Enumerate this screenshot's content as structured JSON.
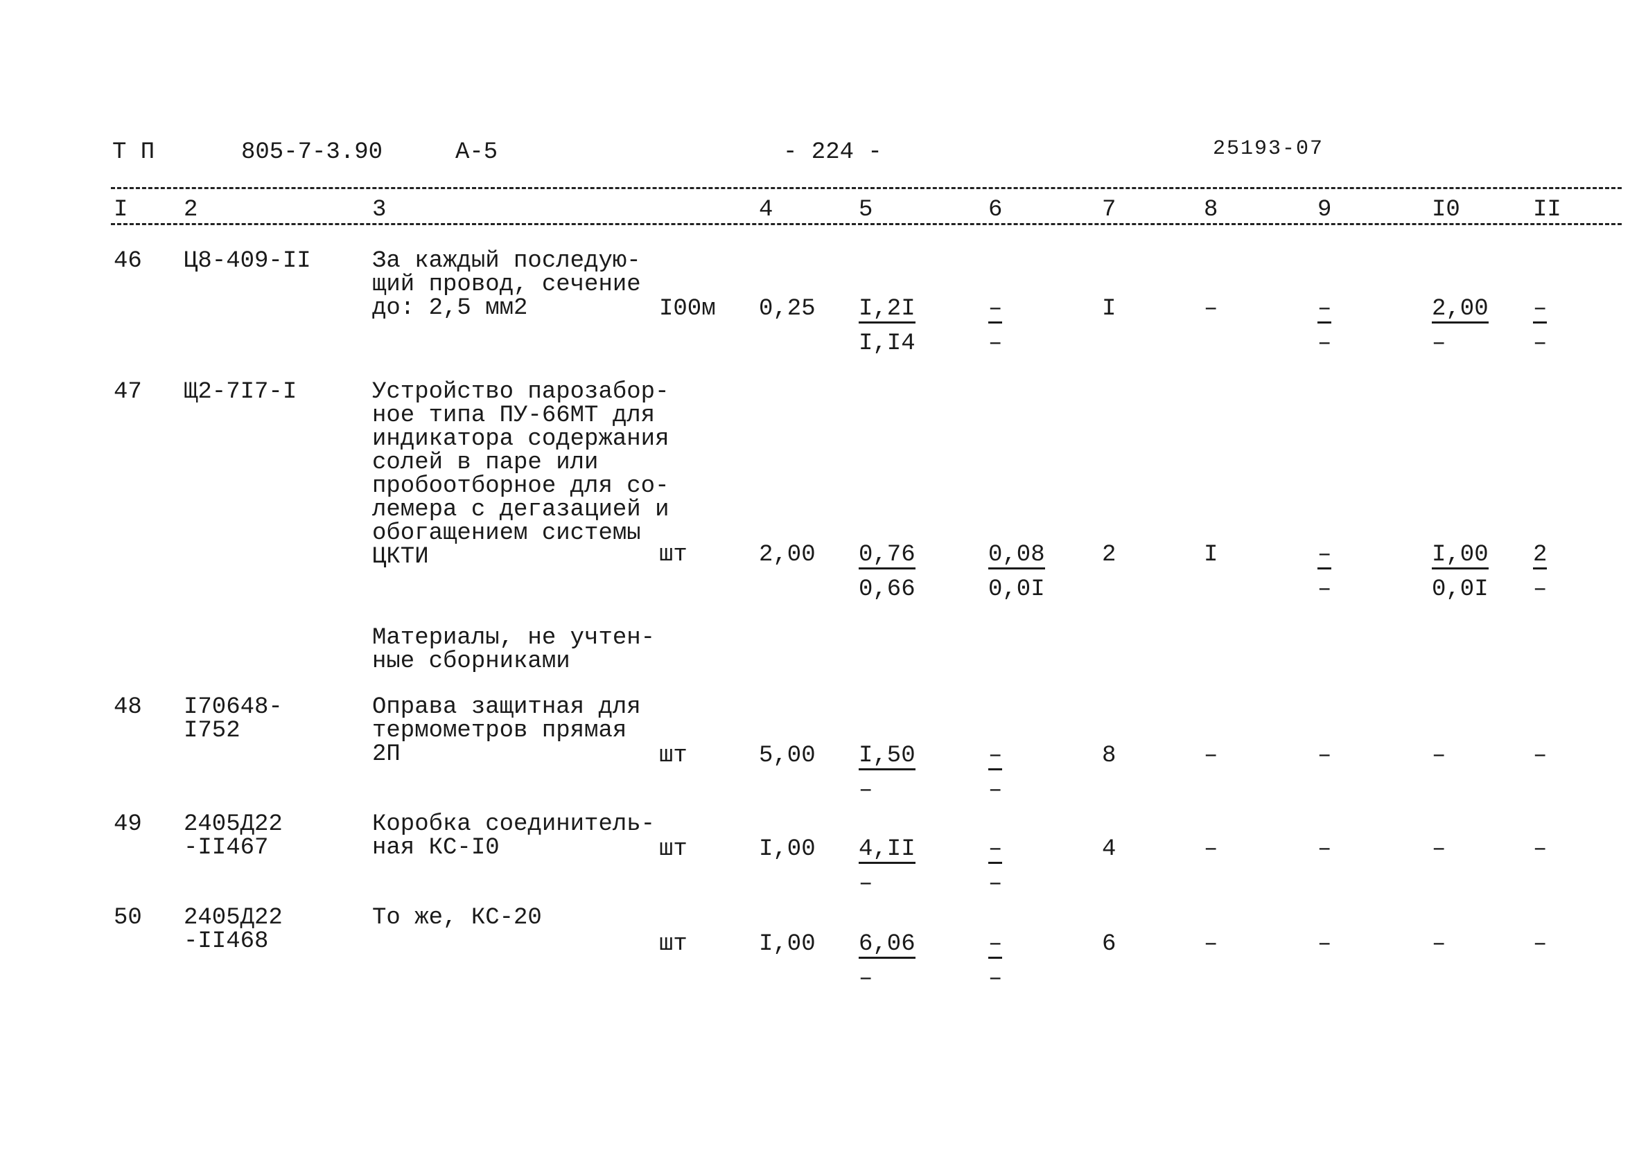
{
  "header": {
    "series": "Т П",
    "project": "805-7-3.90",
    "album": "А-5",
    "page": "- 224 -",
    "stamp": "25193-07"
  },
  "columns": [
    "I",
    "2",
    "3",
    "4",
    "5",
    "6",
    "7",
    "8",
    "9",
    "I0",
    "II"
  ],
  "rows": [
    {
      "num": "46",
      "code": [
        "Ц8-409-II"
      ],
      "desc": [
        "За каждый последую-",
        "щий провод, сечение",
        "до: 2,5 мм2"
      ],
      "unit": "I00м",
      "qty": "0,25",
      "cells": [
        {
          "top": "I,2I",
          "bottom": "I,I4",
          "u": true
        },
        {
          "top": "–",
          "bottom": "–",
          "u": true
        },
        {
          "top": "I"
        },
        {
          "top": "–"
        },
        {
          "top": "–",
          "bottom": "–",
          "u": true
        },
        {
          "top": "2,00",
          "bottom": "–",
          "u": true
        },
        {
          "top": "–",
          "bottom": "–",
          "u": true
        }
      ]
    },
    {
      "num": "47",
      "code": [
        "Щ2-7I7-I"
      ],
      "desc": [
        "Устройство парозабор-",
        "ное типа ПУ-66МТ для",
        "индикатора содержания",
        "солей в паре или",
        "пробоотборное для со-",
        "лемера с дегазацией и",
        "обогащением системы",
        "ЦКТИ"
      ],
      "unit": "шт",
      "qty": "2,00",
      "cells": [
        {
          "top": "0,76",
          "bottom": "0,66",
          "u": true
        },
        {
          "top": "0,08",
          "bottom": "0,0I",
          "u": true
        },
        {
          "top": "2"
        },
        {
          "top": "I"
        },
        {
          "top": "–",
          "bottom": "–",
          "u": true
        },
        {
          "top": "I,00",
          "bottom": "0,0I",
          "u": true
        },
        {
          "top": "2",
          "bottom": "–",
          "u": true
        }
      ]
    },
    {
      "num": "",
      "code": [],
      "desc": [
        "Материалы, не учтен-",
        "ные сборниками"
      ],
      "unit": "",
      "qty": "",
      "cells": []
    },
    {
      "num": "48",
      "code": [
        "I70648-",
        "I752"
      ],
      "desc": [
        "Оправа защитная для",
        "термометров прямая",
        "2П"
      ],
      "unit": "шт",
      "qty": "5,00",
      "cells": [
        {
          "top": "I,50",
          "bottom": "–",
          "u": true
        },
        {
          "top": "–",
          "bottom": "–",
          "u": true
        },
        {
          "top": "8"
        },
        {
          "top": "–"
        },
        {
          "top": "–"
        },
        {
          "top": "–"
        },
        {
          "top": "–"
        }
      ]
    },
    {
      "num": "49",
      "code": [
        "2405Д22",
        "-II467"
      ],
      "desc": [
        "Коробка соединитель-",
        "ная КС-I0"
      ],
      "unit": "шт",
      "qty": "I,00",
      "cells": [
        {
          "top": "4,II",
          "bottom": "–",
          "u": true
        },
        {
          "top": "–",
          "bottom": "–",
          "u": true
        },
        {
          "top": "4"
        },
        {
          "top": "–"
        },
        {
          "top": "–"
        },
        {
          "top": "–"
        },
        {
          "top": "–"
        }
      ]
    },
    {
      "num": "50",
      "code": [
        "2405Д22",
        "-II468"
      ],
      "desc": [
        "То же, КС-20"
      ],
      "unit": "шт",
      "qty": "I,00",
      "cells": [
        {
          "top": "6,06",
          "bottom": "–",
          "u": true
        },
        {
          "top": "–",
          "bottom": "–",
          "u": true
        },
        {
          "top": "6"
        },
        {
          "top": "–"
        },
        {
          "top": "–"
        },
        {
          "top": "–"
        },
        {
          "top": "–"
        }
      ]
    }
  ]
}
